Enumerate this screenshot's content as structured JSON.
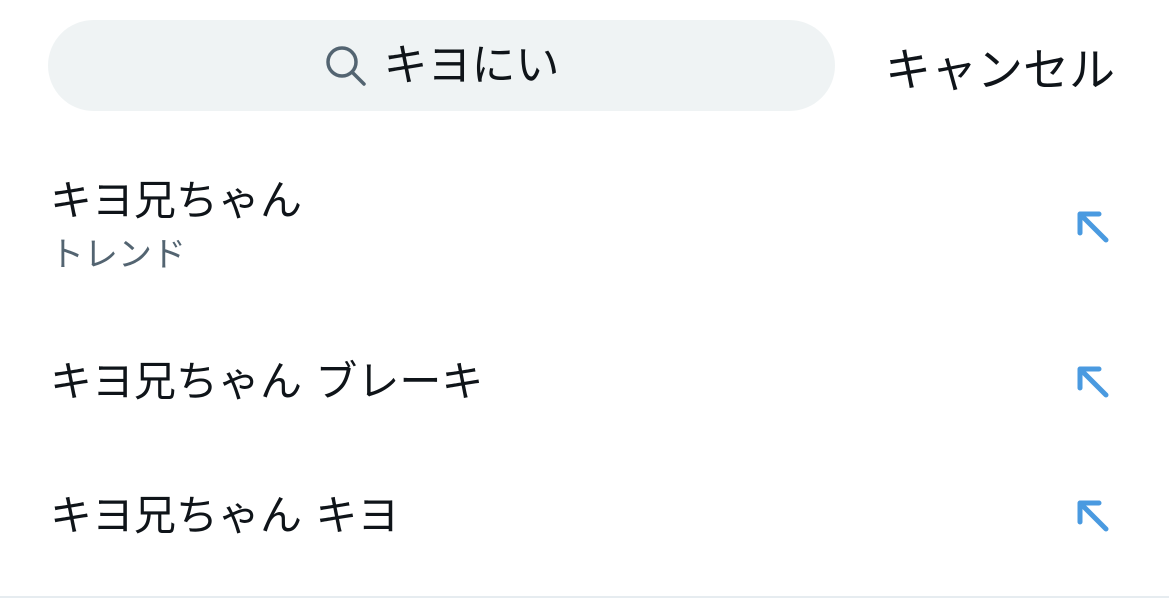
{
  "search": {
    "value": "キヨにい",
    "icon": "search-icon"
  },
  "header": {
    "cancel_label": "キャンセル"
  },
  "suggestions": [
    {
      "text": "キヨ兄ちゃん",
      "subtext": "トレンド",
      "icon": "arrow-up-left-icon"
    },
    {
      "text": "キヨ兄ちゃん ブレーキ",
      "icon": "arrow-up-left-icon"
    },
    {
      "text": "キヨ兄ちゃん キヨ",
      "icon": "arrow-up-left-icon"
    }
  ],
  "colors": {
    "search_bg": "#eff3f4",
    "text_primary": "#0f1419",
    "text_secondary": "#536471",
    "accent": "#4a9ae0"
  }
}
